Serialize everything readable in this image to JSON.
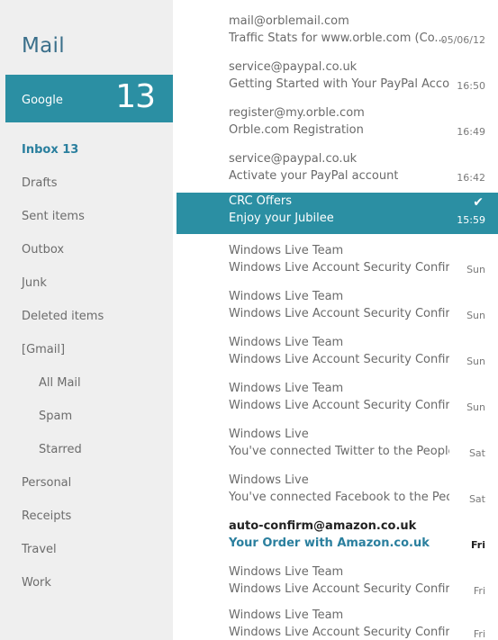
{
  "app": {
    "title": "Mail"
  },
  "account": {
    "name": "Google",
    "unread_count": "13"
  },
  "folders": [
    {
      "label": "Inbox  13"
    },
    {
      "label": "Drafts"
    },
    {
      "label": "Sent items"
    },
    {
      "label": "Outbox"
    },
    {
      "label": "Junk"
    },
    {
      "label": "Deleted items"
    },
    {
      "label": "[Gmail]"
    },
    {
      "label": "All Mail"
    },
    {
      "label": "Spam"
    },
    {
      "label": "Starred"
    },
    {
      "label": "Personal"
    },
    {
      "label": "Receipts"
    },
    {
      "label": "Travel"
    },
    {
      "label": "Work"
    }
  ],
  "messages": [
    {
      "from": "mail@orblemail.com",
      "subject": "Traffic Stats for www.orble.com (Co...",
      "date": "05/06/12"
    },
    {
      "from": "service@paypal.co.uk",
      "subject": "Getting Started with Your PayPal Acco...",
      "date": "16:50"
    },
    {
      "from": "register@my.orble.com",
      "subject": "Orble.com Registration",
      "date": "16:49"
    },
    {
      "from": "service@paypal.co.uk",
      "subject": "Activate your PayPal account",
      "date": "16:42"
    },
    {
      "from": "CRC Offers",
      "subject": "Enjoy your Jubilee",
      "date": "15:59",
      "selected": true
    },
    {
      "from": "Windows Live Team",
      "subject": "Windows Live Account Security Confirm...",
      "date": "Sun"
    },
    {
      "from": "Windows Live Team",
      "subject": "Windows Live Account Security Confirm...",
      "date": "Sun"
    },
    {
      "from": "Windows Live Team",
      "subject": "Windows Live Account Security Confirm...",
      "date": "Sun"
    },
    {
      "from": "Windows Live Team",
      "subject": "Windows Live Account Security Confirm...",
      "date": "Sun"
    },
    {
      "from": "Windows Live",
      "subject": "You've connected Twitter to the People...",
      "date": "Sat"
    },
    {
      "from": "Windows Live",
      "subject": "You've connected Facebook to the Peo...",
      "date": "Sat"
    },
    {
      "from": "auto-confirm@amazon.co.uk",
      "subject": "Your Order with Amazon.co.uk",
      "date": "Fri",
      "unread": true
    },
    {
      "from": "Windows Live Team",
      "subject": "Windows Live Account Security Confirm...",
      "date": "Fri"
    },
    {
      "from": "Windows Live Team",
      "subject": "Windows Live Account Security Confirm...",
      "date": "Fri"
    }
  ],
  "colors": {
    "accent": "#2b8fa3",
    "sidebar_bg": "#efefef",
    "title": "#3a6f8a"
  },
  "icons": {
    "selected_marker": "checkmark-icon"
  }
}
